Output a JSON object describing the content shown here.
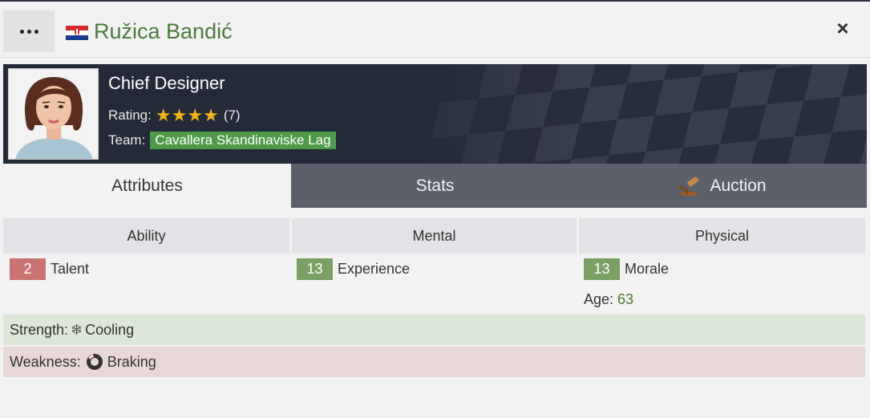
{
  "header": {
    "name": "Ružica Bandić",
    "flag_icon": "croatia-flag-icon",
    "close_icon": "×",
    "name_color": "#4a7a3a"
  },
  "profile": {
    "role": "Chief Designer",
    "rating_label": "Rating:",
    "rating_stars": 4,
    "rating_count": "(7)",
    "team_label": "Team:",
    "team_name": "Cavallera Skandinaviske Lag",
    "team_color": "#4e9a4a",
    "star_color": "#f2b31c"
  },
  "tabs": [
    {
      "label": "Attributes",
      "active": true
    },
    {
      "label": "Stats",
      "active": false
    },
    {
      "label": "Auction",
      "active": false,
      "icon": "gavel-icon"
    }
  ],
  "columns": [
    "Ability",
    "Mental",
    "Physical"
  ],
  "attributes": {
    "talent": {
      "value": "2",
      "label": "Talent",
      "color": "#c97373"
    },
    "experience": {
      "value": "13",
      "label": "Experience",
      "color": "#7aa066"
    },
    "morale": {
      "value": "13",
      "label": "Morale",
      "color": "#7aa066"
    }
  },
  "age": {
    "label": "Age:",
    "value": "63"
  },
  "strength": {
    "label": "Strength:",
    "icon": "snowflake-icon",
    "value": "Cooling"
  },
  "weakness": {
    "label": "Weakness:",
    "icon": "brake-disc-icon",
    "value": "Braking"
  }
}
